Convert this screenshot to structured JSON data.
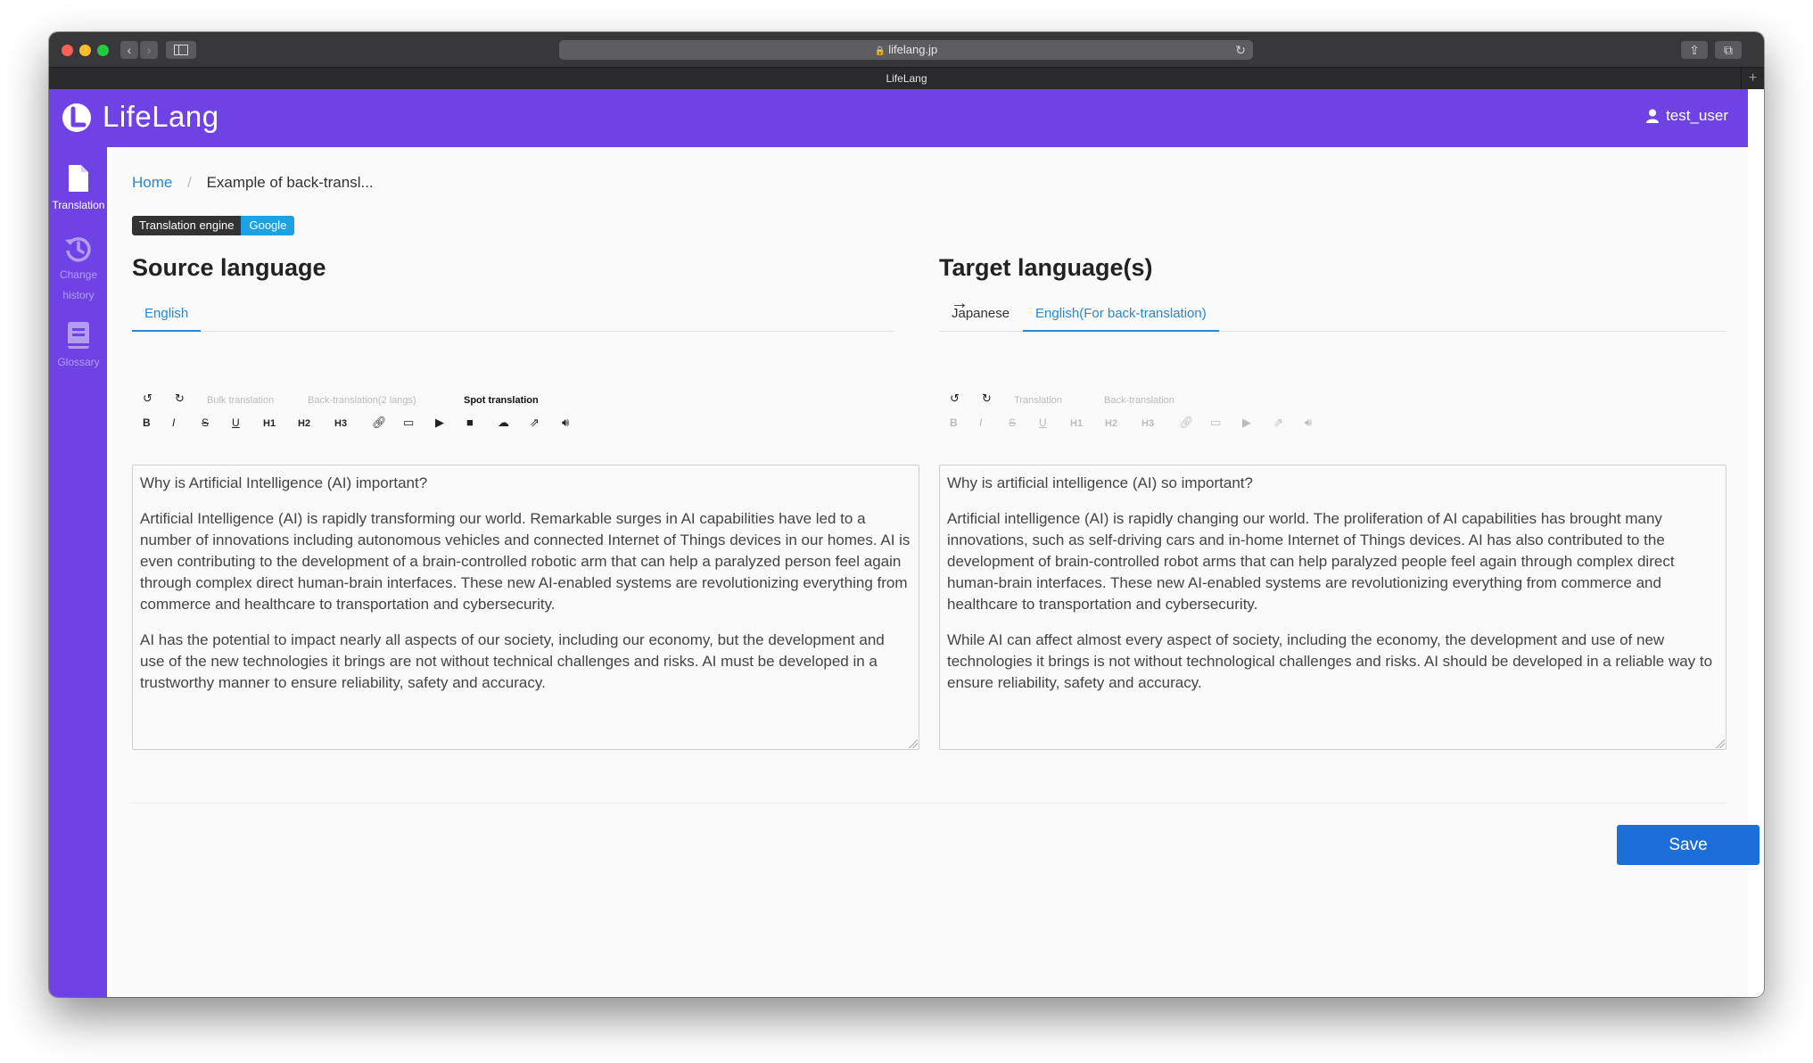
{
  "browser": {
    "url": "lifelang.jp",
    "tab_title": "LifeLang"
  },
  "app": {
    "name": "LifeLang",
    "brand_color": "#6f42e6",
    "user": "test_user"
  },
  "sidebar": {
    "items": [
      {
        "label": "Translation",
        "icon": "file-icon",
        "active": true
      },
      {
        "label": "Change history",
        "icon": "history-icon",
        "active": false
      },
      {
        "label": "Glossary",
        "icon": "book-icon",
        "active": false
      }
    ]
  },
  "breadcrumb": {
    "home": "Home",
    "current": "Example of back-transl..."
  },
  "engine": {
    "label": "Translation engine",
    "value": "Google"
  },
  "source": {
    "title": "Source language",
    "tabs": [
      "English"
    ],
    "toolbar_actions": [
      "Bulk translation",
      "Back-translation(2 langs)",
      "Spot translation"
    ],
    "format_tools": [
      "B",
      "I",
      "S",
      "U",
      "H1",
      "H2",
      "H3",
      "link",
      "image",
      "youtube",
      "video",
      "upload",
      "share",
      "audio"
    ],
    "paragraphs": [
      "Why is Artificial Intelligence (AI) important?",
      "Artificial Intelligence (AI) is rapidly transforming our world. Remarkable surges in AI capabilities have led to a number of innovations including autonomous vehicles and connected Internet of Things devices in our homes. AI is even contributing to the development of a brain-controlled robotic arm that can help a paralyzed person feel again through complex direct human-brain interfaces. These new AI-enabled systems are revolutionizing everything from commerce and healthcare to transportation and cybersecurity.",
      "AI has the potential to impact nearly all aspects of our society, including our economy, but the development and use of the new technologies it brings are not without technical challenges and risks. AI must be developed in a trustworthy manner to ensure reliability, safety and accuracy."
    ]
  },
  "target": {
    "title": "Target language(s)",
    "tabs": [
      "Japanese",
      "English(For back-translation)"
    ],
    "toolbar_actions": [
      "Translation",
      "Back-translation"
    ],
    "paragraphs": [
      "Why is artificial intelligence (AI) so important?",
      "Artificial intelligence (AI) is rapidly changing our world. The proliferation of AI capabilities has brought many innovations, such as self-driving cars and in-home Internet of Things devices. AI has also contributed to the development of brain-controlled robot arms that can help paralyzed people feel again through complex direct human-brain interfaces. These new AI-enabled systems are revolutionizing everything from commerce and healthcare to transportation and cybersecurity.",
      "While AI can affect almost every aspect of society, including the economy, the development and use of new technologies it brings is not without technological challenges and risks. AI should be developed in a reliable way to ensure reliability, safety and accuracy."
    ]
  },
  "save_label": "Save"
}
